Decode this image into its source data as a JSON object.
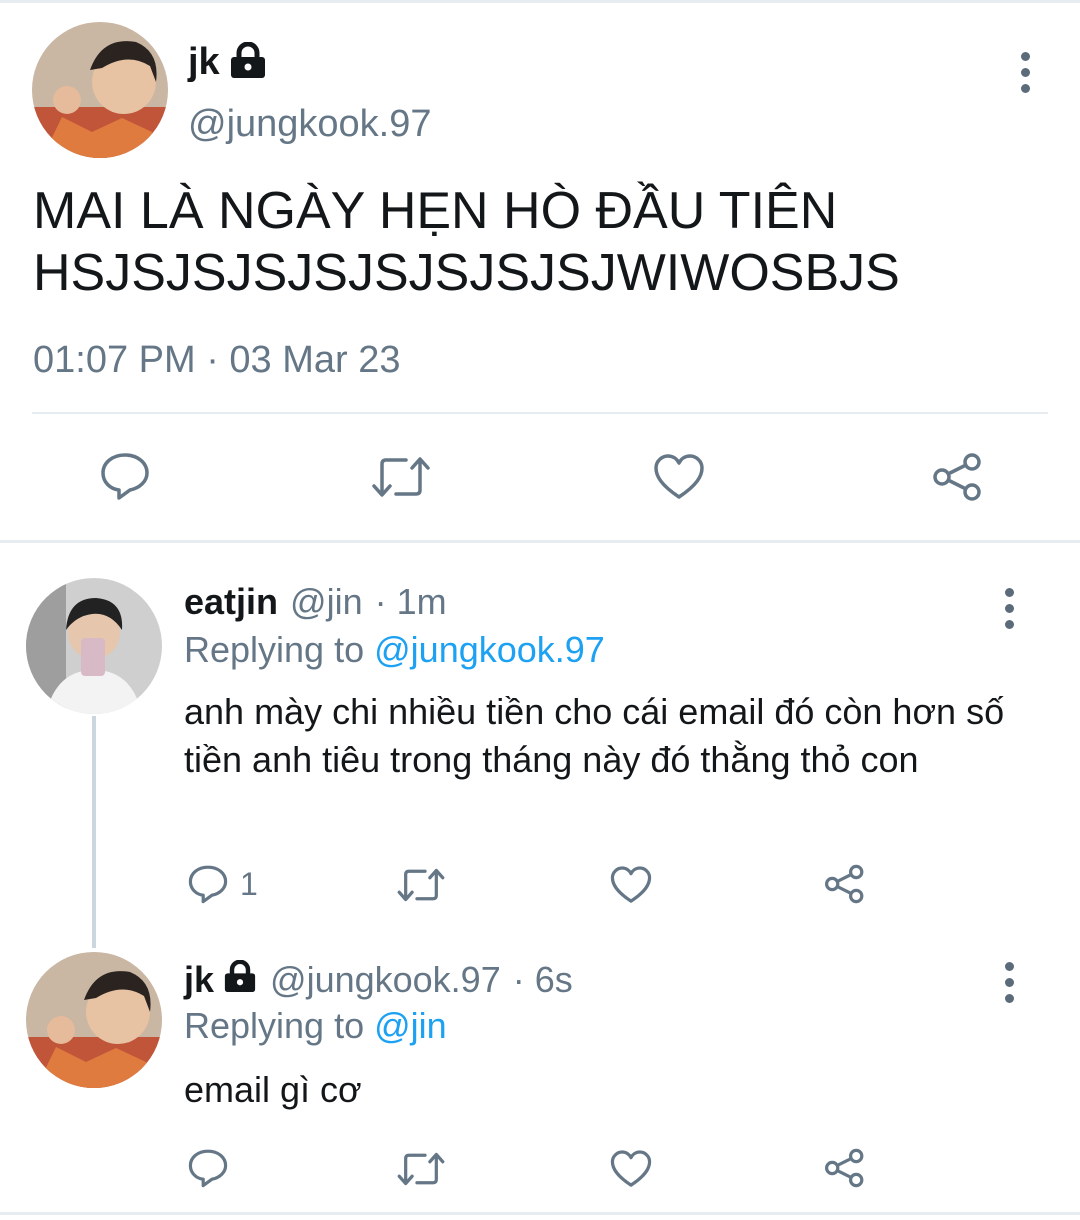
{
  "main_tweet": {
    "name": "jk",
    "handle": "@jungkook.97",
    "text_line1": "MAI LÀ NGÀY HẸN HÒ ĐẦU TIÊN",
    "text_line2": "HSJSJSJSJSJSJSJSJSJWIWOSBJS",
    "timestamp": "01:07 PM · 03 Mar 23"
  },
  "replies": [
    {
      "name": "eatjin",
      "handle": "@jin",
      "time": "· 1m",
      "replying_label": "Replying to",
      "replying_handle": "@jungkook.97",
      "text": "anh mày chi nhiều tiền cho cái email đó còn hơn số tiền anh tiêu trong tháng này đó thằng thỏ con",
      "reply_count": "1"
    },
    {
      "name": "jk",
      "handle": "@jungkook.97",
      "time": "· 6s",
      "replying_label": "Replying to",
      "replying_handle": "@jin",
      "text": "email gì cơ",
      "reply_count": ""
    }
  ],
  "icons": [
    "lock-icon",
    "more-vertical-icon",
    "reply-icon",
    "retweet-icon",
    "like-icon",
    "share-icon"
  ],
  "colors": {
    "text": "#14171a",
    "secondary": "#657786",
    "link": "#1da1f2",
    "divider": "#e6ecf0"
  }
}
